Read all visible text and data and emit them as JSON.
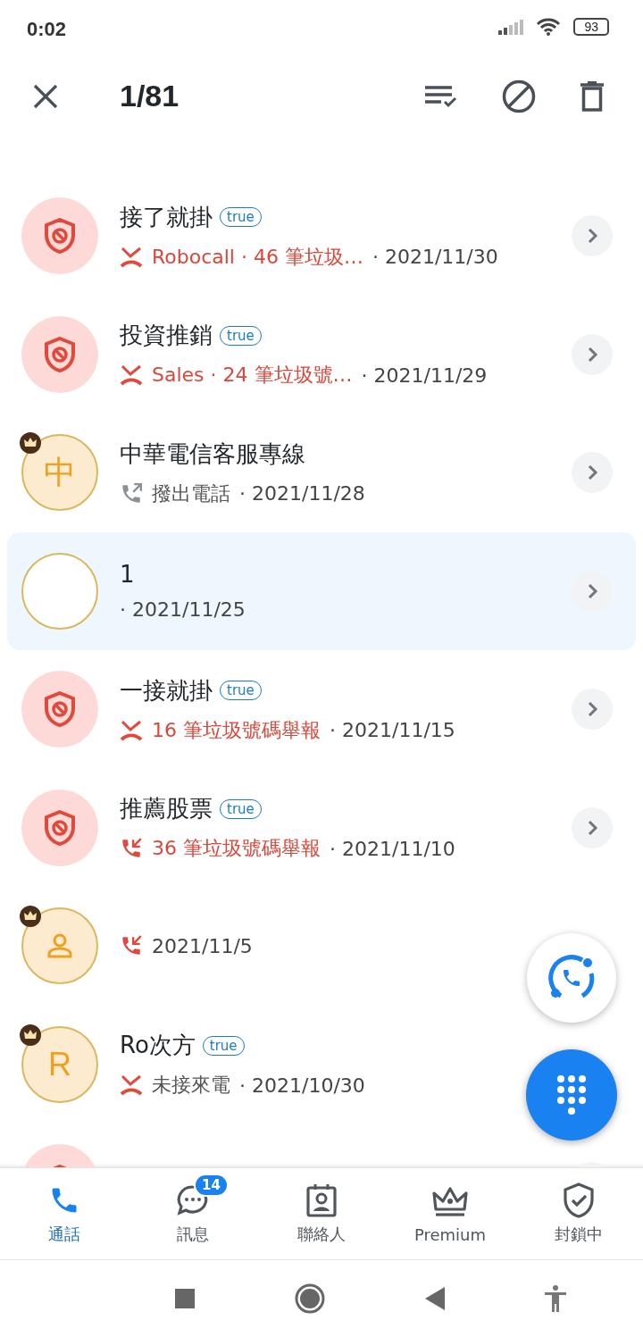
{
  "status_bar": {
    "time": "0:02",
    "battery": "93"
  },
  "toolbar": {
    "count": "1/81"
  },
  "calls": [
    {
      "avatar": {
        "kind": "spam"
      },
      "premium": false,
      "name": "接了就掛",
      "tag": "true",
      "call": {
        "kind": "missed"
      },
      "alert": true,
      "detail": "Robocall · 46 筆垃圾…",
      "date": "· 2021/11/30",
      "selected": false
    },
    {
      "avatar": {
        "kind": "spam"
      },
      "premium": false,
      "name": "投資推銷",
      "tag": "true",
      "call": {
        "kind": "missed"
      },
      "alert": true,
      "detail": "Sales · 24 筆垃圾號…",
      "date": "· 2021/11/29",
      "selected": false
    },
    {
      "avatar": {
        "kind": "letter",
        "letter": "中"
      },
      "premium": true,
      "name": "中華電信客服專線",
      "call": {
        "kind": "outgoing"
      },
      "alert": false,
      "detail": "撥出電話",
      "date": "· 2021/11/28",
      "selected": false
    },
    {
      "avatar": {
        "kind": "blank"
      },
      "premium": false,
      "name": "1",
      "date": "· 2021/11/25",
      "selected": true
    },
    {
      "avatar": {
        "kind": "spam"
      },
      "premium": false,
      "name": "一接就掛",
      "tag": "true",
      "call": {
        "kind": "missed"
      },
      "alert": true,
      "detail": "16 筆垃圾號碼舉報",
      "date": "· 2021/11/15",
      "selected": false
    },
    {
      "avatar": {
        "kind": "spam"
      },
      "premium": false,
      "name": "推薦股票",
      "tag": "true",
      "call": {
        "kind": "incoming"
      },
      "alert": true,
      "detail": "36 筆垃圾號碼舉報",
      "date": "· 2021/11/10",
      "selected": false
    },
    {
      "avatar": {
        "kind": "person"
      },
      "premium": true,
      "call": {
        "kind": "incoming"
      },
      "date": "2021/11/5",
      "selected": false
    },
    {
      "avatar": {
        "kind": "letter",
        "letter": "R"
      },
      "premium": true,
      "name": "Ro次方",
      "tag": "true",
      "call": {
        "kind": "missed"
      },
      "alert": false,
      "detail": "未接來電",
      "date": "· 2021/10/30",
      "selected": false
    },
    {
      "avatar": {
        "kind": "spam"
      },
      "premium": false,
      "selected": false
    }
  ],
  "tabs": [
    {
      "label": "通話",
      "selected": true
    },
    {
      "label": "訊息",
      "badge": "14",
      "selected": false
    },
    {
      "label": "聯絡人",
      "selected": false
    },
    {
      "label": "Premium",
      "selected": false
    },
    {
      "label": "封鎖中",
      "selected": false
    }
  ]
}
